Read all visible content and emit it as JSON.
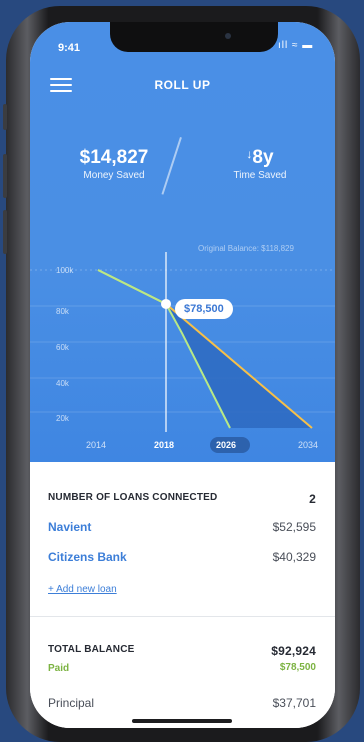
{
  "status": {
    "time": "9:41",
    "icons": "ıll ≈ ▬"
  },
  "header": {
    "title": "ROLL UP",
    "menu_icon": "hamburger-menu-icon"
  },
  "stats": {
    "money": {
      "value": "$14,827",
      "label": "Money Saved"
    },
    "time": {
      "arrow": "↓",
      "value": "8y",
      "label": "Time Saved"
    }
  },
  "chart_data": {
    "type": "line",
    "y_tick_labels": [
      "100k",
      "80k",
      "60k",
      "40k",
      "20k"
    ],
    "y_ticks": [
      100000,
      80000,
      60000,
      40000,
      20000
    ],
    "x_tick_labels": [
      "2014",
      "2018",
      "2026",
      "2034"
    ],
    "selected_x": "2026",
    "cursor_x": "2018",
    "annotation": "Original Balance: $118,829",
    "tooltip": "$78,500",
    "series": [
      {
        "points": [
          [
            2014,
            100000
          ],
          [
            2018,
            78500
          ],
          [
            2034,
            0
          ]
        ],
        "color": "#f7c048"
      },
      {
        "points": [
          [
            2014,
            100000
          ],
          [
            2018,
            78500
          ],
          [
            2020,
            60000
          ],
          [
            2026,
            0
          ]
        ],
        "color": "#b8e986"
      }
    ],
    "fill_color": "#2f6bc2"
  },
  "loans": {
    "header": "NUMBER OF LOANS CONNECTED",
    "count": "2",
    "items": [
      {
        "name": "Navient",
        "amount": "$52,595"
      },
      {
        "name": "Citizens Bank",
        "amount": "$40,329"
      }
    ],
    "add_label": "+ Add new loan"
  },
  "totals": {
    "label": "TOTAL BALANCE",
    "value": "$92,924",
    "paid_label": "Paid",
    "paid_value": "$78,500",
    "principal_label": "Principal",
    "principal_value": "$37,701"
  }
}
